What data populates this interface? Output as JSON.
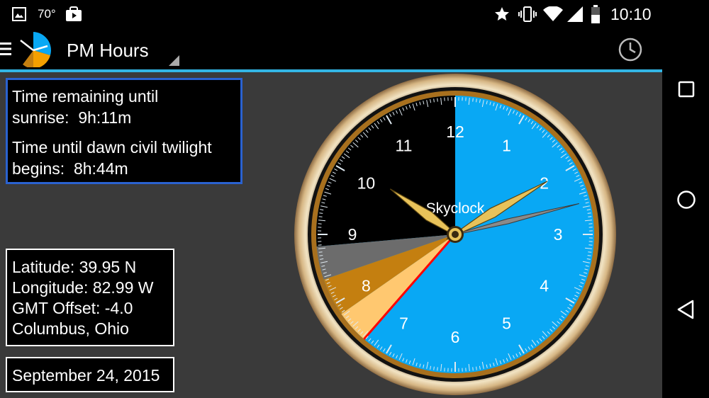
{
  "status_bar": {
    "temperature": "70°",
    "time": "10:10",
    "icons": [
      "gallery-icon",
      "shopping-bag-icon",
      "star-icon",
      "vibrate-icon",
      "wifi-icon",
      "signal-icon",
      "battery-icon"
    ]
  },
  "app_bar": {
    "title": "PM Hours",
    "icons": [
      "menu-icon",
      "app-logo-icon",
      "dropdown-arrow-icon",
      "clock-history-icon"
    ],
    "accent_color": "#33b5e5"
  },
  "twilight": {
    "sunrise_label": "Time remaining until sunrise:",
    "sunrise_value": "9h:11m",
    "dawn_label": "Time until dawn civil twilight begins:",
    "dawn_value": "8h:44m"
  },
  "location": {
    "latitude": "Latitude: 39.95 N",
    "longitude": "Longitude: 82.99 W",
    "gmt_offset": "GMT Offset: -4.0",
    "city": "Columbus, Ohio"
  },
  "date": "September 24, 2015",
  "clock": {
    "label": "Skyclock",
    "numerals": [
      "12",
      "1",
      "2",
      "3",
      "4",
      "5",
      "6",
      "7",
      "8",
      "9",
      "10",
      "11"
    ],
    "colors": {
      "night": "#000000",
      "day": "#09a8f4",
      "astronomical_twilight": "#6c6c6c",
      "nautical_twilight": "#c47f10",
      "civil_twilight": "#ffc870",
      "sunrise_line": "#ff0000",
      "hand": "#e8c25a",
      "second_hand": "#8a8a8a"
    }
  },
  "nav_bar": {
    "icons": [
      "recents-icon",
      "home-icon",
      "back-icon"
    ]
  }
}
